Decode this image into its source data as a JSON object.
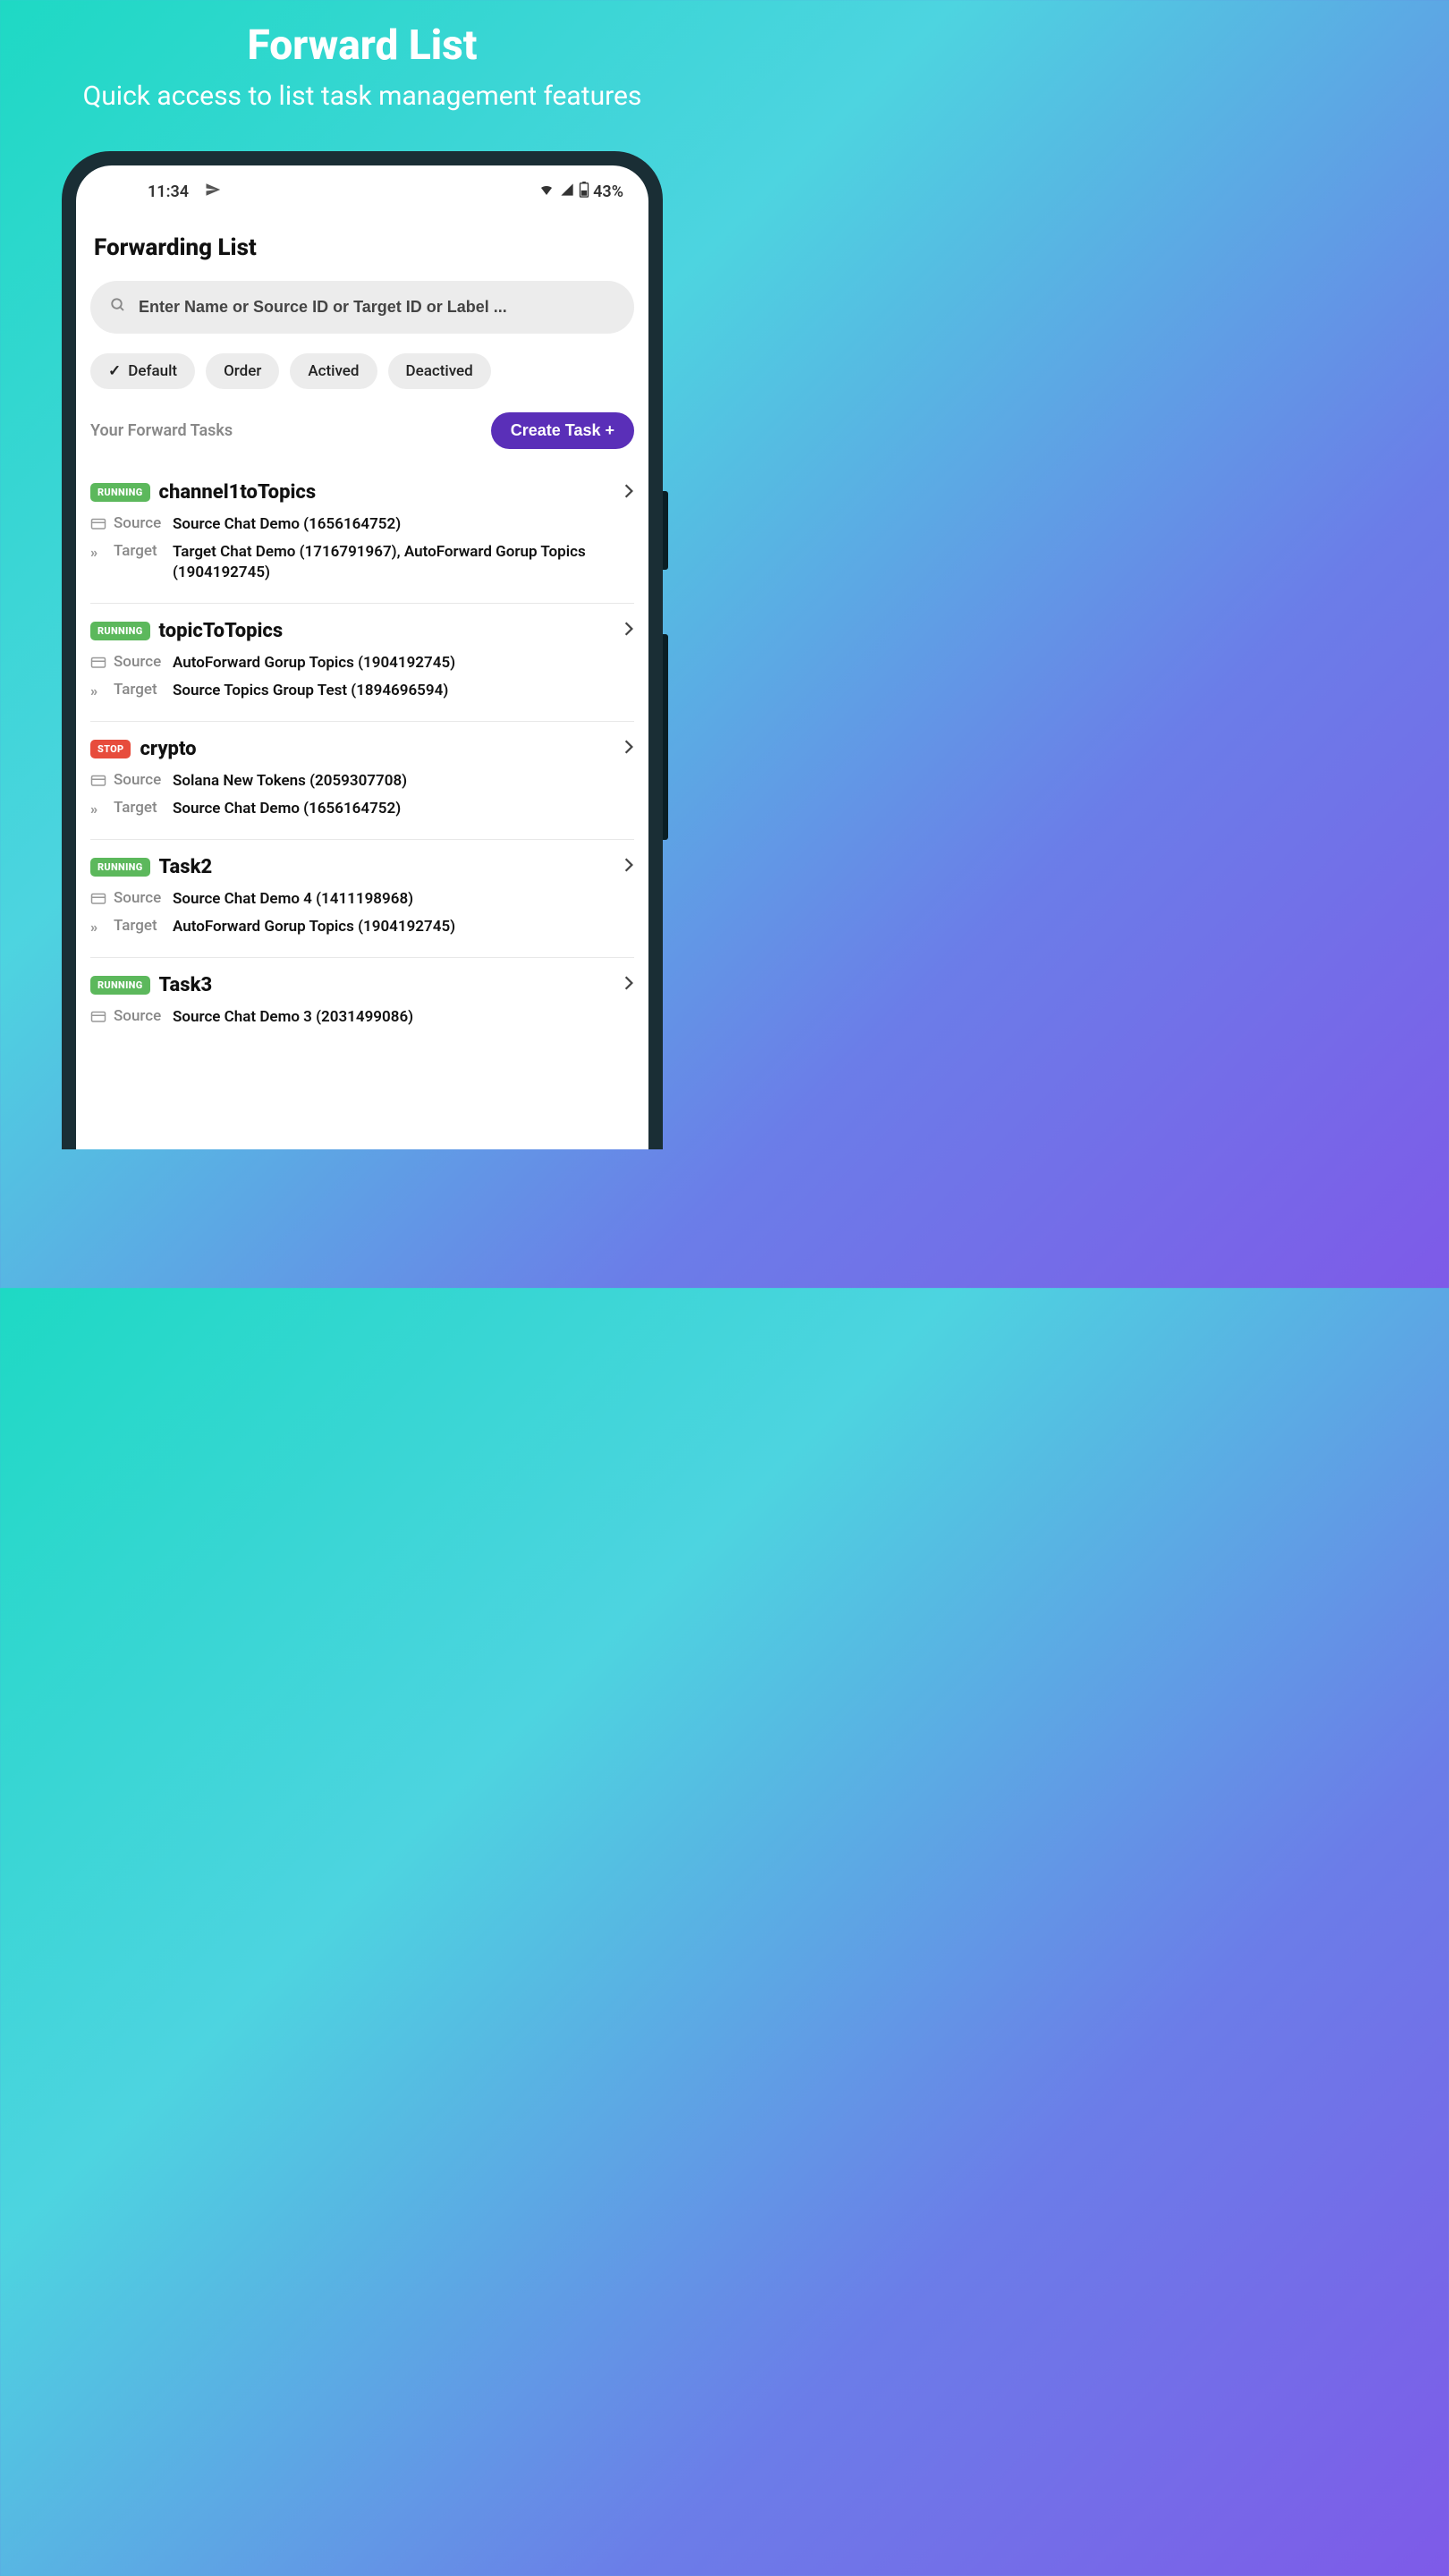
{
  "promo": {
    "title": "Forward List",
    "subtitle": "Quick access to list task management features"
  },
  "status": {
    "time": "11:34",
    "battery": "43%"
  },
  "page": {
    "title": "Forwarding List"
  },
  "search": {
    "placeholder": "Enter Name or Source ID or Target ID or Label ..."
  },
  "filters": [
    {
      "label": "Default",
      "active": true
    },
    {
      "label": "Order",
      "active": false
    },
    {
      "label": "Actived",
      "active": false
    },
    {
      "label": "Deactived",
      "active": false
    }
  ],
  "section": {
    "label": "Your Forward Tasks",
    "create": "Create Task +"
  },
  "tasks": [
    {
      "status": "RUNNING",
      "name": "channel1toTopics",
      "source": "Source Chat Demo (1656164752)",
      "target": "Target Chat Demo (1716791967), AutoForward Gorup Topics (1904192745)"
    },
    {
      "status": "RUNNING",
      "name": "topicToTopics",
      "source": "AutoForward Gorup Topics (1904192745)",
      "target": "Source Topics Group Test (1894696594)"
    },
    {
      "status": "STOP",
      "name": "crypto",
      "source": "Solana New Tokens (2059307708)",
      "target": "Source Chat Demo (1656164752)"
    },
    {
      "status": "RUNNING",
      "name": "Task2",
      "source": "Source Chat Demo 4 (1411198968)",
      "target": "AutoForward Gorup Topics (1904192745)"
    },
    {
      "status": "RUNNING",
      "name": "Task3",
      "source": "Source Chat Demo 3 (2031499086)",
      "target": ""
    }
  ],
  "labels": {
    "source": "Source",
    "target": "Target"
  }
}
